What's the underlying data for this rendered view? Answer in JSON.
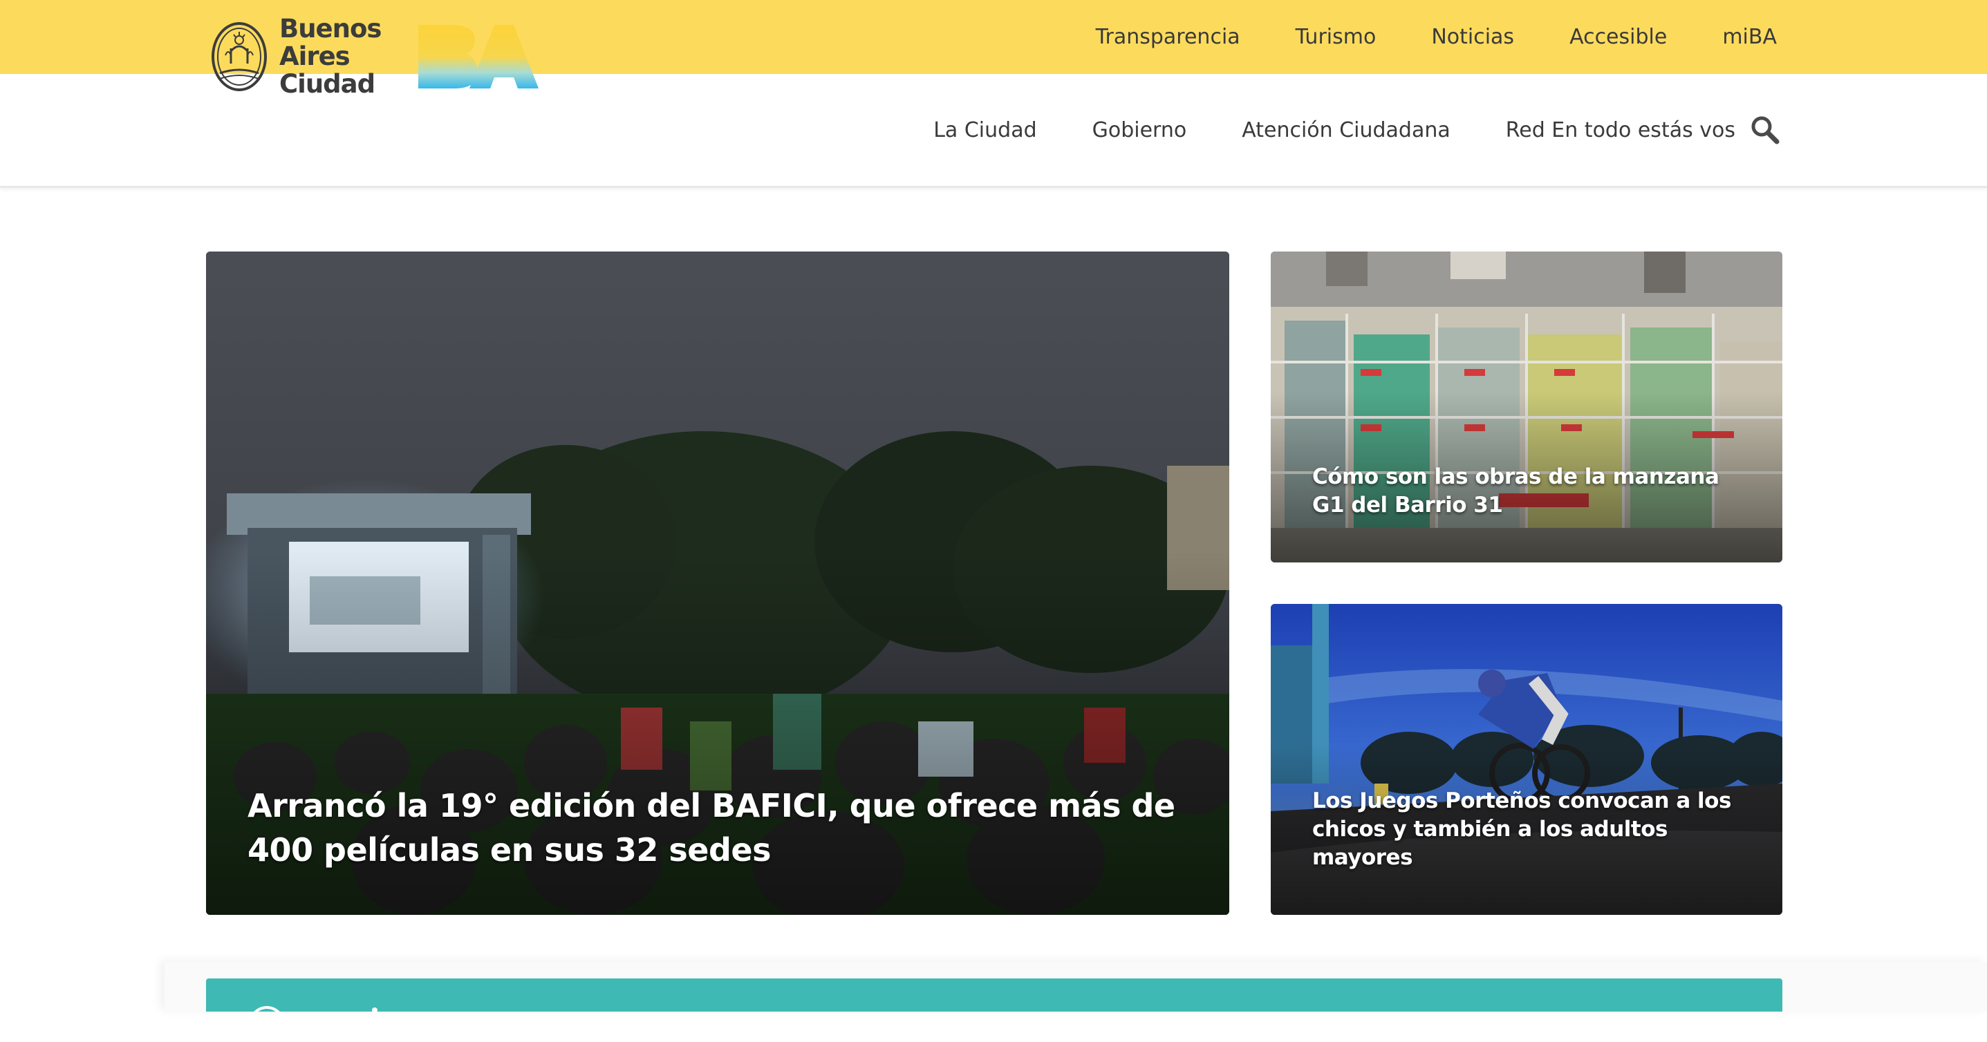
{
  "topbar": {
    "links": [
      "Transparencia",
      "Turismo",
      "Noticias",
      "Accesible",
      "miBA"
    ]
  },
  "header": {
    "logo_lines": [
      "Buenos",
      "Aires",
      "Ciudad"
    ],
    "nav": [
      "La Ciudad",
      "Gobierno",
      "Atención Ciudadana",
      "Red En todo estás vos"
    ],
    "search_icon": "search-icon"
  },
  "cards": {
    "main_title": "Arrancó la 19° edición del BAFICI, que ofrece más de 400 películas en sus 32 sedes",
    "top_title": "Cómo son las obras de la manzana G1 del Barrio 31",
    "bottom_title": "Los Juegos Porteños convocan a los chicos y también a los adultos mayores"
  },
  "colors": {
    "topbar": "#fcdb5c",
    "teal": "#3fb9b3",
    "text": "#3a3a3a"
  }
}
